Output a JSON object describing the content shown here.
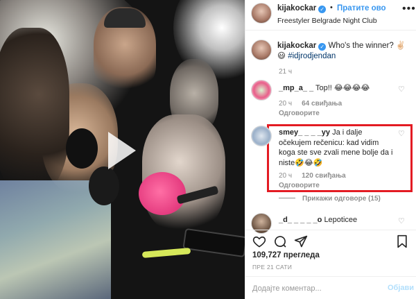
{
  "header": {
    "username": "kijakockar",
    "verified_mark": "✓",
    "separator": "•",
    "follow_label": "Пратите ово",
    "location": "Freestyler Belgrade Night Club",
    "more_glyph": "•••"
  },
  "caption": {
    "username": "kijakockar",
    "text": "Who's the winner? ✌🏻",
    "emoji": "😃",
    "hashtag": "#idjrodjendan",
    "time": "21 ч"
  },
  "comments": [
    {
      "username": "_mp_a_ _",
      "text": "Top!! 😂😂😂😂",
      "time": "20 ч",
      "likes": "64 свиђања",
      "reply": "Одговорите"
    },
    {
      "username": "smey_ _ _ _yy",
      "text": "Ja i dalje očekujem rečenicu: kad vidim koga ste sve zvali mene bolje da i niste🤣😂🤣",
      "time": "20 ч",
      "likes": "120 свиђања",
      "reply": "Одговорите"
    },
    {
      "username": "_d_ _ _ _ _o",
      "text": "Lepoticee"
    }
  ],
  "view_replies": "Прикажи одговоре (15)",
  "stats": {
    "views": "109,727 прегледа",
    "posted_ago": "ПРЕ 21 САТИ"
  },
  "add_comment": {
    "placeholder": "Додајте коментар...",
    "post_label": "Објави"
  },
  "icons": [
    "play-icon",
    "heart-icon",
    "comment-icon",
    "share-icon",
    "bookmark-icon",
    "more-icon",
    "verified-icon"
  ],
  "colors": {
    "accent_blue": "#3897f0",
    "highlight_red": "#e31b23",
    "muted_gray": "#8e8e8e",
    "hashtag_blue": "#003569"
  }
}
